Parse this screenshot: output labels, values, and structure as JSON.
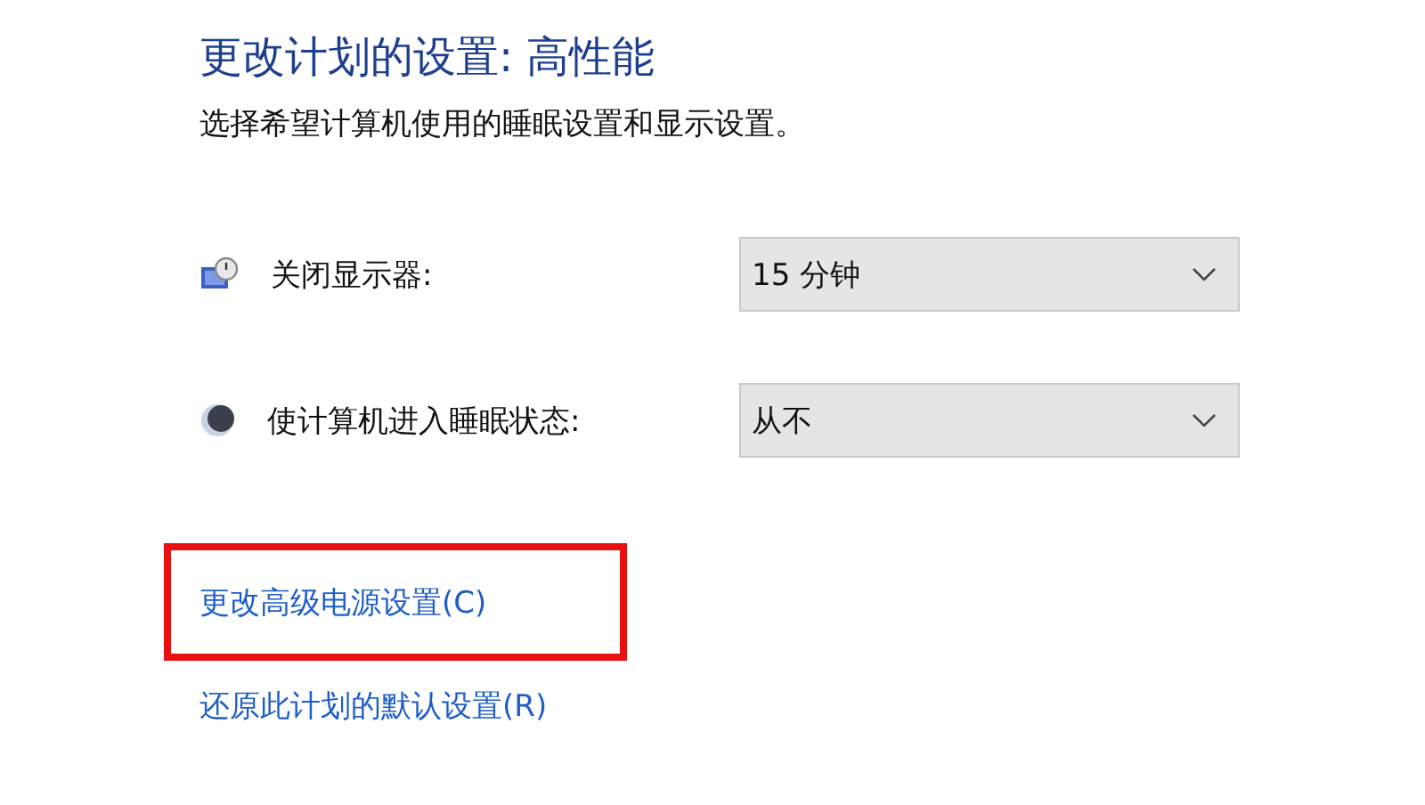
{
  "title": "更改计划的设置: 高性能",
  "subtitle": "选择希望计算机使用的睡眠设置和显示设置。",
  "settings": [
    {
      "kind": "display",
      "label": "关闭显示器:",
      "value": "15 分钟"
    },
    {
      "kind": "sleep",
      "label": "使计算机进入睡眠状态:",
      "value": "从不"
    }
  ],
  "links": [
    {
      "label": "更改高级电源设置(C)",
      "highlighted": true
    },
    {
      "label": "还原此计划的默认设置(R)",
      "highlighted": false
    }
  ]
}
